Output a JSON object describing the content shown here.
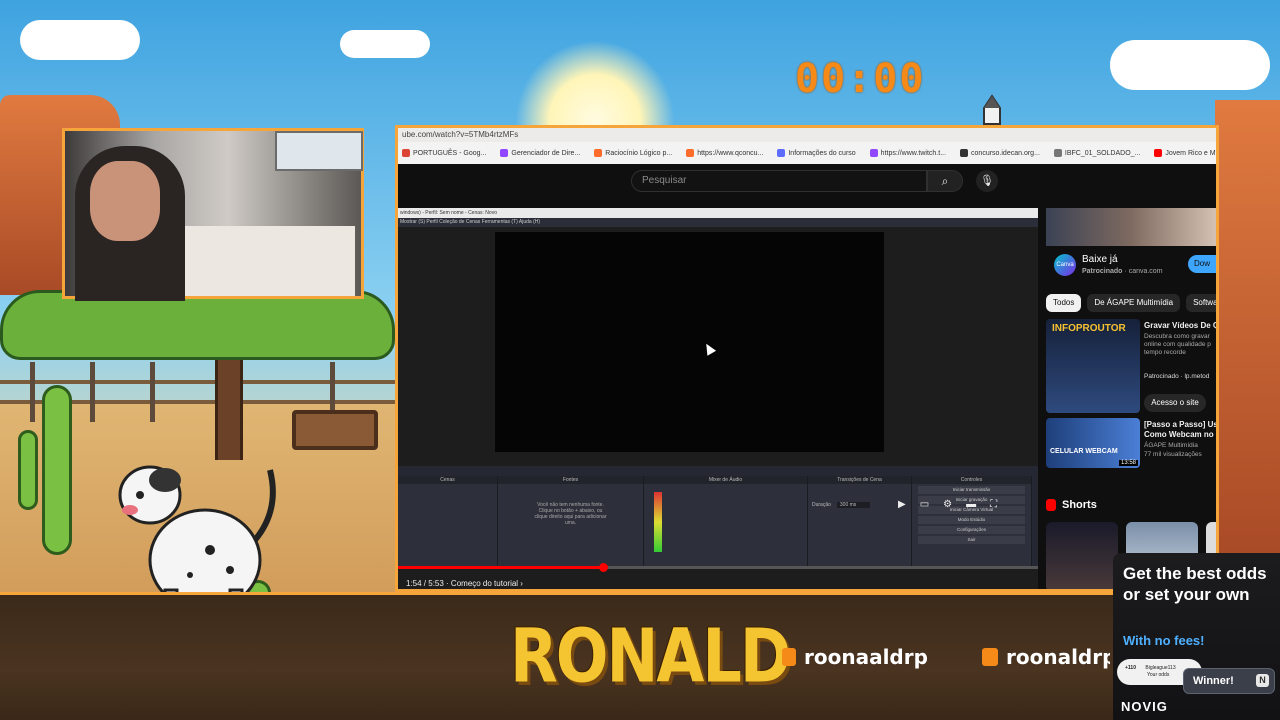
{
  "timer": "00:00",
  "browser": {
    "url_fragment": "ube.com/watch?v=5TMb4rtzMFs",
    "bookmarks": [
      {
        "label": "PORTUGUÊS - Goog...",
        "color": "#db4437"
      },
      {
        "label": "Gerenciador de Dire...",
        "color": "#9146ff"
      },
      {
        "label": "Raciocínio Lógico p...",
        "color": "#ff6b2b"
      },
      {
        "label": "https://www.qconcu...",
        "color": "#ff6b2b"
      },
      {
        "label": "Informações do curso",
        "color": "#5b6cff"
      },
      {
        "label": "https://www.twitch.t...",
        "color": "#9146ff"
      },
      {
        "label": "concurso.idecan.org...",
        "color": "#333333"
      },
      {
        "label": "IBFC_01_SOLDADO_...",
        "color": "#777777"
      },
      {
        "label": "Jovem Rico e Mima...",
        "color": "#ff0000"
      }
    ],
    "search_placeholder": "Pesquisar"
  },
  "obs": {
    "titlebar": "windows) - Perfil: Sem nome - Cenas: Novo",
    "menu": "Mostrar (S)   Perfil   Coleção de Cenas   Ferramentas (T)   Ajuda (H)",
    "dock_titles": [
      "Cenas",
      "Fontes",
      "Mixer de Áudio",
      "Transições de Cena",
      "Controles"
    ],
    "sources_empty": "Você não tem nenhuma fonte. Clique no botão + abaixo, ou clique direito aqui para adicionar uma.",
    "controls": [
      "Iniciar transmissão",
      "Iniciar gravação",
      "Iniciar Câmera Virtual",
      "Modo Estúdio",
      "Configurações",
      "Sair"
    ],
    "duration_label": "Duração",
    "duration_value": "300 ms"
  },
  "player": {
    "time": "1:54 / 5:53",
    "chapter": "Começo do tutorial",
    "progress": 0.32
  },
  "sidebar": {
    "ad": {
      "title": "Baixe já",
      "sponsor": "Patrocinado",
      "domain": "canva.com",
      "button": "Dow"
    },
    "chips": [
      "Todos",
      "De ÁGAPE Multimídia",
      "Software"
    ],
    "recs": [
      {
        "title": "Gravar Vídeos De Q",
        "meta": "Descubra como gravar online com qualidade p tempo recorde",
        "meta2": "Patrocinado · lp.metod",
        "thumb_text": "INFOPROUTOR"
      },
      {
        "title": "[Passo a Passo] Usa Como Webcam no P",
        "meta": "ÁGAPE Multimídia",
        "meta2": "77 mil visualizações",
        "thumb_text": "CELULAR WEBCAM",
        "duration": "13:58"
      }
    ],
    "ad_button": "Acesso o site",
    "shorts": "Shorts"
  },
  "overlay": {
    "name": "RONALD",
    "tiktok": "roonaaldrp",
    "twitch": "roonaldrp"
  },
  "novig": {
    "headline": "Get the best odds or set your own",
    "sub": "With no fees!",
    "card_user": "Bigleague113",
    "card_sub": "Your odds",
    "card_odds": "+110",
    "winner": "Winner!",
    "badge": "N",
    "brand": "NOVIG"
  }
}
